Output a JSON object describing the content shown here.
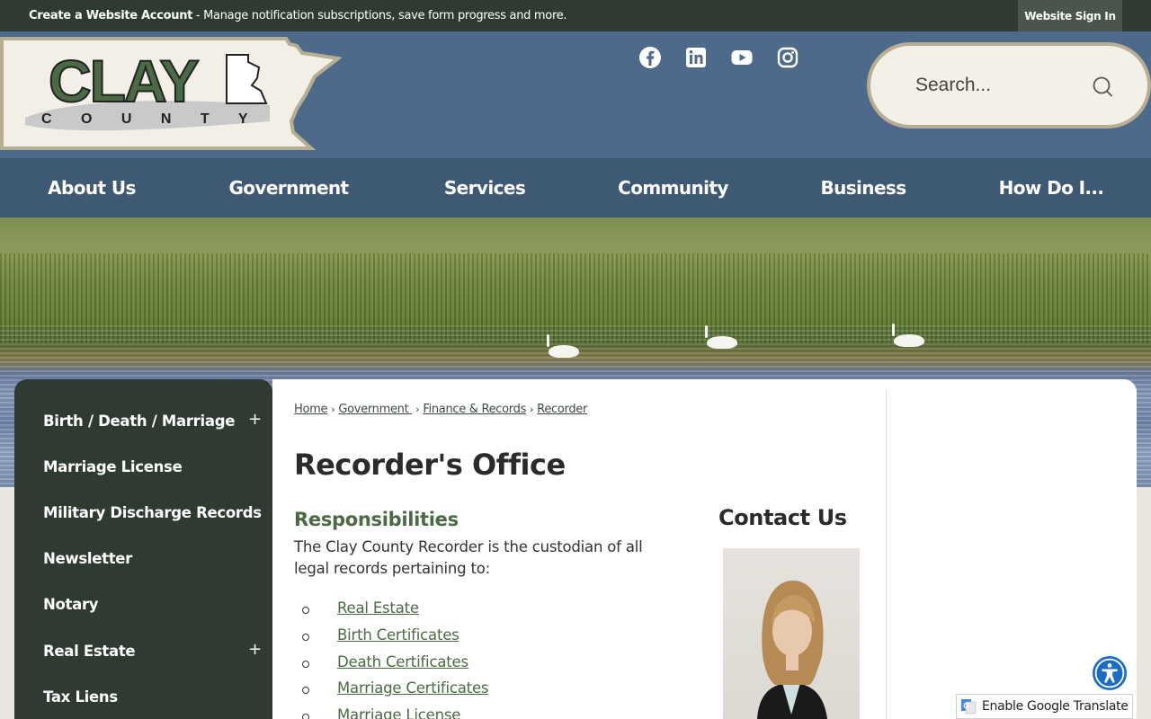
{
  "topbar": {
    "account_link": "Create a Website Account",
    "account_text": " - Manage notification subscriptions, save form progress and more.",
    "signin": "Website Sign In"
  },
  "header": {
    "logo_line1": "CLAY",
    "logo_line2": "C O U N T Y",
    "social": [
      "facebook-icon",
      "linkedin-icon",
      "youtube-icon",
      "instagram-icon"
    ],
    "search_placeholder": "Search..."
  },
  "nav": {
    "items": [
      "About Us",
      "Government",
      "Services",
      "Community",
      "Business",
      "How Do I..."
    ]
  },
  "sidenav": {
    "items": [
      {
        "label": "Birth / Death / Marriage",
        "expand": "+"
      },
      {
        "label": "Marriage License",
        "expand": ""
      },
      {
        "label": "Military Discharge Records",
        "expand": ""
      },
      {
        "label": "Newsletter",
        "expand": ""
      },
      {
        "label": "Notary",
        "expand": ""
      },
      {
        "label": "Real Estate",
        "expand": "+"
      },
      {
        "label": "Tax Liens",
        "expand": ""
      }
    ]
  },
  "breadcrumb": {
    "items": [
      "Home",
      "Government ",
      "Finance & Records",
      "Recorder"
    ],
    "separator": "›"
  },
  "main": {
    "title": "Recorder's Office",
    "responsibilities_heading": "Responsibilities",
    "description": "The Clay County Recorder is the custodian of all legal records pertaining to:",
    "records": [
      "Real Estate",
      "Birth Certificates",
      "Death Certificates",
      "Marriage Certificates",
      "Marriage License"
    ]
  },
  "contact": {
    "heading": "Contact Us"
  },
  "translate": {
    "label": "Enable Google Translate"
  },
  "colors": {
    "topbar": "#2f3b32",
    "header": "#4e6a8a",
    "nav": "#3d5974",
    "sidenav": "#2f3b32",
    "accent_green": "#4a6a43"
  }
}
